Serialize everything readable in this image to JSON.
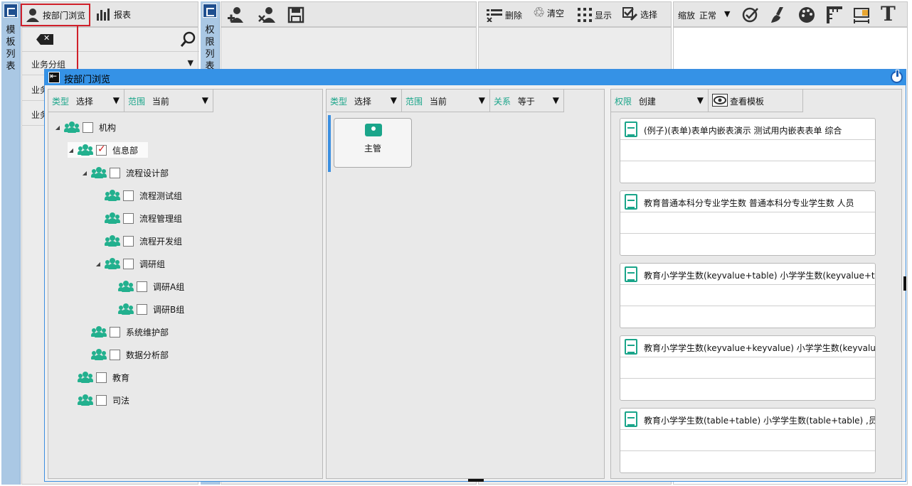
{
  "app": {
    "left_strip": {
      "vertical_label": [
        "模",
        "板",
        "列",
        "表"
      ]
    },
    "left_toolbar": {
      "dept_browse_label": "按部门浏览",
      "report_label": "报表"
    },
    "left_list": {
      "items": [
        "业务分组",
        "业务",
        "业务"
      ]
    },
    "perm_strip": {
      "vertical_label": [
        "权",
        "限",
        "列",
        "表"
      ]
    },
    "mid_toolbar": {
      "delete_label": "删除",
      "clear_label": "清空",
      "show_label": "显示",
      "select_label": "选择"
    },
    "right_toolbar": {
      "zoom_label": "缩放",
      "zoom_value": "正常"
    }
  },
  "dialog": {
    "title": "按部门浏览",
    "org_panel": {
      "filters": [
        {
          "key": "类型",
          "value": "选择"
        },
        {
          "key": "范围",
          "value": "当前"
        }
      ],
      "tree": [
        {
          "label": "机构",
          "checked": false,
          "expanded": true
        },
        {
          "label": "信息部",
          "checked": true,
          "expanded": true
        },
        {
          "label": "流程设计部",
          "checked": false,
          "expanded": true
        },
        {
          "label": "流程测试组",
          "checked": false
        },
        {
          "label": "流程管理组",
          "checked": false
        },
        {
          "label": "流程开发组",
          "checked": false
        },
        {
          "label": "调研组",
          "checked": false,
          "expanded": true
        },
        {
          "label": "调研A组",
          "checked": false
        },
        {
          "label": "调研B组",
          "checked": false
        },
        {
          "label": "系统维护部",
          "checked": false
        },
        {
          "label": "数据分析部",
          "checked": false
        },
        {
          "label": "教育",
          "checked": false
        },
        {
          "label": "司法",
          "checked": false
        }
      ]
    },
    "role_panel": {
      "filters": [
        {
          "key": "类型",
          "value": "选择"
        },
        {
          "key": "范围",
          "value": "当前"
        },
        {
          "key": "关系",
          "value": "等于"
        }
      ],
      "roles": [
        {
          "label": "主管"
        }
      ]
    },
    "template_panel": {
      "filter": {
        "key": "权限",
        "value": "创建"
      },
      "view_template_label": "查看模板",
      "templates": [
        {
          "title": "(例子)(表单)表单内嵌表演示   测试用内嵌表表单          综合"
        },
        {
          "title": "教育普通本科分专业学生数  普通本科分专业学生数       人员"
        },
        {
          "title": "教育小学学生数(keyvalue+table)   小学学生数(keyvalue+ta"
        },
        {
          "title": "教育小学学生数(keyvalue+keyvalue)   小学学生数(keyvalue"
        },
        {
          "title": "教育小学学生数(table+table)   小学学生数(table+table) ,员"
        }
      ]
    }
  },
  "colors": {
    "accent_teal": "#1aa58a",
    "title_blue": "#3592e6",
    "highlight_red": "#d01818",
    "strip_blue": "#aac8e4"
  }
}
